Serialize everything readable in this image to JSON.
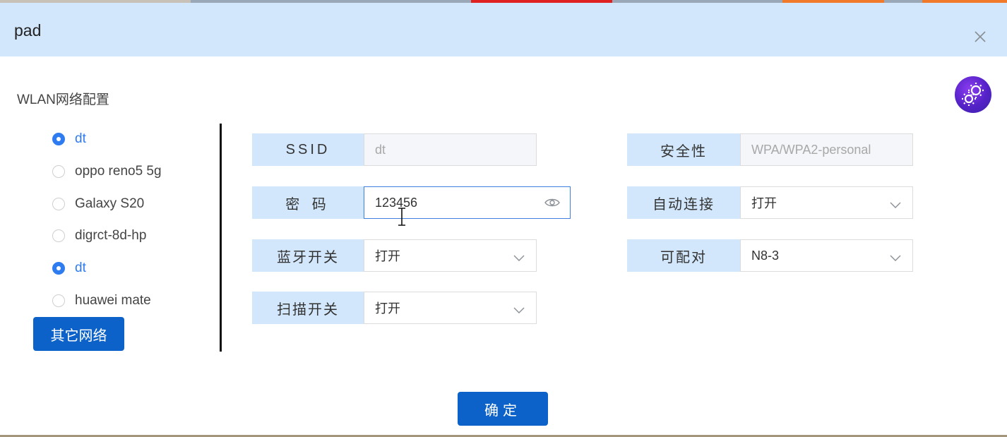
{
  "dialog": {
    "title": "pad"
  },
  "section": {
    "title": "WLAN网络配置"
  },
  "networks": [
    {
      "label": "dt",
      "selected": true
    },
    {
      "label": "oppo reno5 5g",
      "selected": false
    },
    {
      "label": "Galaxy S20",
      "selected": false
    },
    {
      "label": "digrct-8d-hp",
      "selected": false
    },
    {
      "label": "dt",
      "selected": true
    },
    {
      "label": "huawei mate",
      "selected": false
    }
  ],
  "buttons": {
    "other_networks": "其它网络",
    "confirm": "确定"
  },
  "form": {
    "ssid": {
      "label": "SSID",
      "value": "dt"
    },
    "password": {
      "label": "密 码",
      "value": "123456"
    },
    "bluetooth": {
      "label": "蓝牙开关",
      "value": "打开"
    },
    "scan": {
      "label": "扫描开关",
      "value": "打开"
    },
    "security": {
      "label": "安全性",
      "value": "WPA/WPA2-personal"
    },
    "auto_connect": {
      "label": "自动连接",
      "value": "打开"
    },
    "pairable": {
      "label": "可配对",
      "value": "N8-3"
    }
  },
  "colors": {
    "accent": "#0c62c8",
    "selected": "#2f7cf0",
    "label_bg": "#d2e7fb"
  },
  "icons": [
    "close-icon",
    "settings-bot-icon",
    "eye-icon",
    "chevron-down-icon",
    "text-cursor-icon"
  ]
}
